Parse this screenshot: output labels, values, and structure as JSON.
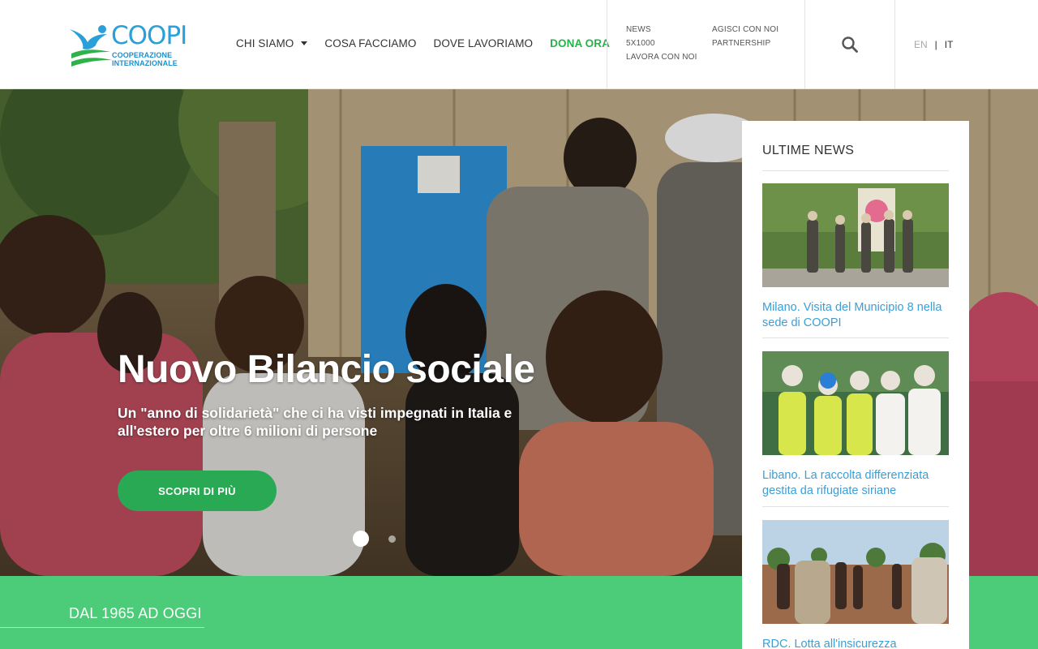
{
  "brand": {
    "logo_word": "COOPI",
    "logo_sub_1": "COOPERAZIONE",
    "logo_sub_2": "INTERNAZIONALE",
    "primary_color": "#2aa955",
    "accent_blue": "#3a9fd6"
  },
  "main_nav": [
    {
      "label": "CHI SIAMO",
      "has_dropdown": true
    },
    {
      "label": "COSA FACCIAMO",
      "has_dropdown": false
    },
    {
      "label": "DOVE LAVORIAMO",
      "has_dropdown": false
    },
    {
      "label": "DONA ORA",
      "has_dropdown": false
    }
  ],
  "secondary_nav": {
    "news": "NEWS",
    "five_per_thousand": "5X1000",
    "work_with_us": "LAVORA CON NOI",
    "act_with_us": "AGISCI CON NOI",
    "partnership": "PARTNERSHIP"
  },
  "search": {
    "icon": "search-icon"
  },
  "language": {
    "en": "EN",
    "separator": "|",
    "it": "IT",
    "active": "IT"
  },
  "hero": {
    "title": "Nuovo Bilancio sociale",
    "subtitle": "Un \"anno di solidarietà\" che ci ha visti impegnati in Italia e all'estero per oltre 6 milioni di persone",
    "cta_label": "SCOPRI DI PIÙ",
    "slides_total": 2,
    "slide_active": 1
  },
  "news_panel": {
    "title": "ULTIME NEWS",
    "items": [
      {
        "caption": "Milano. Visita del Municipio 8 nella sede di COOPI"
      },
      {
        "caption": "Libano. La raccolta differenziata gestita da rifugiate siriane"
      },
      {
        "caption": "RDC. Lotta all'insicurezza"
      }
    ]
  },
  "band": {
    "title": "DAL 1965 AD OGGI",
    "color": "#4ccb78"
  }
}
